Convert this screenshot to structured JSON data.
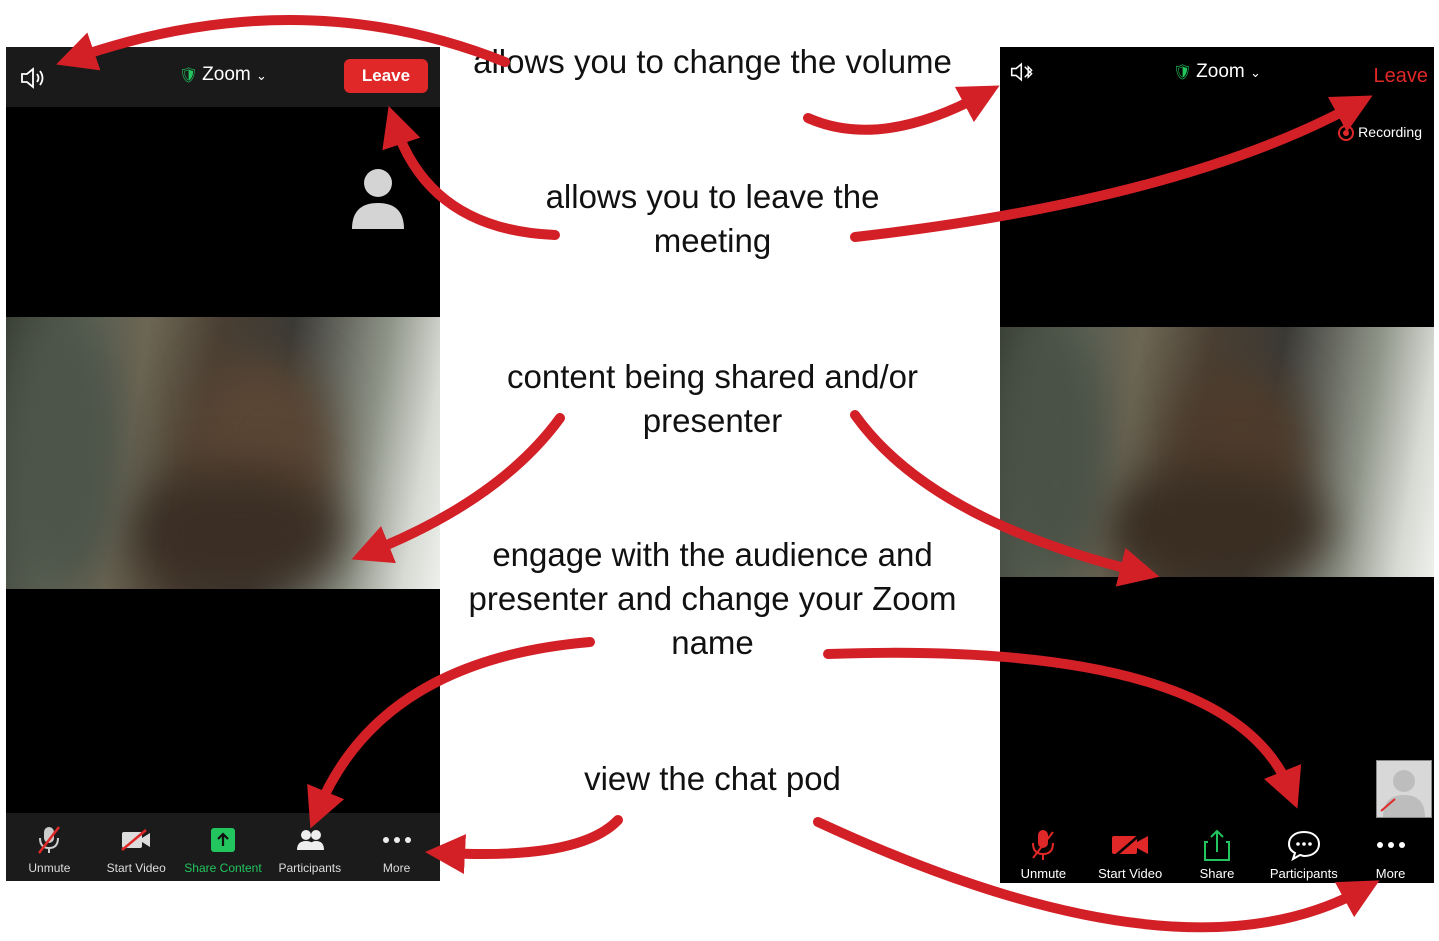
{
  "left_phone": {
    "title": "Zoom",
    "leave_label": "Leave",
    "toolbar": [
      "Unmute",
      "Start Video",
      "Share Content",
      "Participants",
      "More"
    ]
  },
  "right_phone": {
    "title": "Zoom",
    "leave_label": "Leave",
    "recording_label": "Recording",
    "toolbar": [
      "Unmute",
      "Start Video",
      "Share",
      "Participants",
      "More"
    ]
  },
  "callouts": {
    "volume": "allows you to change the volume",
    "leave": "allows you to leave the meeting",
    "content": "content being shared and/or presenter",
    "engage": "engage with the audience and presenter and change your Zoom name",
    "chat": "view the chat pod"
  },
  "colors": {
    "leave_red": "#e02828",
    "arrow_red": "#d32027",
    "shield_green": "#22c55e"
  }
}
